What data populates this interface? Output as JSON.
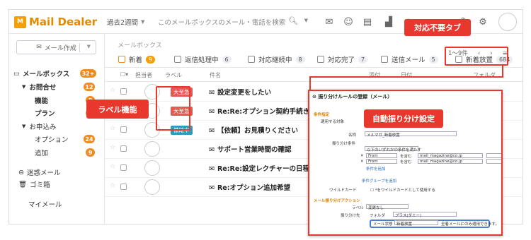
{
  "header": {
    "logo_mark": "M",
    "logo_text": "Mail Dealer",
    "period": "過去2週間",
    "search_placeholder": "このメールボックスのメール・電話を検索"
  },
  "icons": [
    "mail-icon",
    "smile-icon",
    "document-icon",
    "chart-icon",
    "bell-icon",
    "help-icon",
    "gear-icon"
  ],
  "sidebar": {
    "compose": "メール作成",
    "items": [
      {
        "label": "メールボックス",
        "badge": "32+",
        "bold": true
      },
      {
        "label": "お問合せ",
        "badge": "12",
        "bold": true
      },
      {
        "label": "機能",
        "badge": "8",
        "bold": true
      },
      {
        "label": "プラン",
        "badge": "4",
        "bold": true
      },
      {
        "label": "お申込み",
        "badge": "",
        "bold": false
      },
      {
        "label": "オプション",
        "badge": "24",
        "bold": false
      },
      {
        "label": "追加",
        "badge": "9",
        "bold": false
      },
      {
        "label": "迷惑メール",
        "badge": "",
        "bold": false
      },
      {
        "label": "ゴミ箱",
        "badge": "",
        "bold": false
      },
      {
        "label": "マイメール",
        "badge": "",
        "bold": false
      }
    ]
  },
  "mailbox_title": "メールボックス",
  "tabs": [
    {
      "label": "新着",
      "count": "9"
    },
    {
      "label": "返信処理中",
      "count": "6"
    },
    {
      "label": "対応継続中",
      "count": "8"
    },
    {
      "label": "対応完了",
      "count": "7"
    },
    {
      "label": "送信メール",
      "count": "5"
    },
    {
      "label": "新着放置",
      "count": "684"
    }
  ],
  "pager": "1～9件",
  "columns": {
    "assignee": "担当者",
    "label": "ラベル",
    "subject": "件名",
    "attach": "添付",
    "date": "日付",
    "folder": "フォルダ"
  },
  "rows": [
    {
      "label": "大至急",
      "label_color": "#e25a52",
      "subject": "設定変更をしたい"
    },
    {
      "label": "大至急",
      "label_color": "#e25a52",
      "subject": "Re:Re:オプション契約手続きの流れ"
    },
    {
      "label": "備確中",
      "label_color": "#2e9bb8",
      "subject": "【依頼】お見積りください"
    },
    {
      "label": "",
      "label_color": "",
      "subject": "サポート営業時間の確認"
    },
    {
      "label": "",
      "label_color": "",
      "subject": "Re:Re:設定レクチャーの日程調整"
    },
    {
      "label": "",
      "label_color": "",
      "subject": "Re:オプション追加希望"
    }
  ],
  "callouts": {
    "label_feature": "ラベル機能",
    "auto_sort": "自動振り分け設定",
    "no_action_tab": "対応不要タブ"
  },
  "rules_panel": {
    "title": "振り分けルールの登録（メール）",
    "condition_heading": "条件指定",
    "target_label": "適用する対象",
    "name_label": "名称",
    "name_value": "メルマガ_新着放置",
    "condition_label": "振り分け条件",
    "cond_any": "以下のいずれかの条件を満たす",
    "from": "From",
    "match": "を含む",
    "addr1": "mail_magazine@co.jp",
    "addr2": "mail_magazine@co.jp",
    "add_condition": "条件を追加",
    "add_group": "条件グループを追加",
    "wildcard_label": "ワイルドカード",
    "wildcard_text": "*をワイルドカードとして使用する",
    "action_heading": "メール振り分けアクション",
    "label_label": "ラベル",
    "label_value": "変更なし",
    "folder_label": "振り分け先",
    "folder_value": "フォルダ",
    "folder_select": "プラス(ダミー)",
    "state_label": "メール状態",
    "state_value": "新着放置",
    "state_note": "全着メールにのみ適用できます。"
  }
}
